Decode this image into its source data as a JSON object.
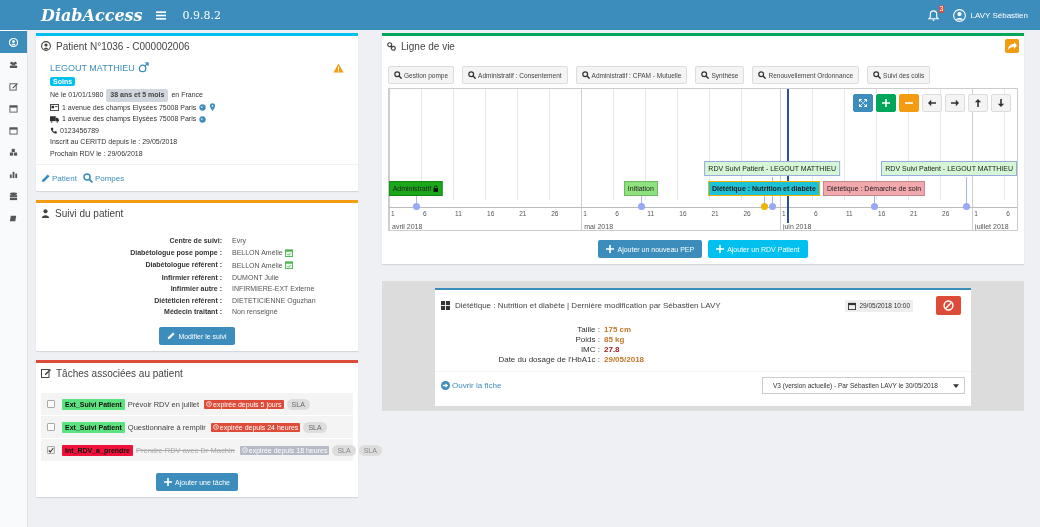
{
  "header": {
    "logo": "DiabAccess",
    "version": "0.9.8.2",
    "notifications": "3",
    "user": "LAVY Sébastien"
  },
  "sidebar": {
    "items": [
      {
        "selected": true
      },
      {
        "selected": false
      },
      {
        "selected": false
      },
      {
        "selected": false
      },
      {
        "selected": false
      },
      {
        "selected": false
      },
      {
        "selected": false
      },
      {
        "selected": false
      },
      {
        "selected": false
      }
    ]
  },
  "patient": {
    "title": "Patient N°1036 - C000002006",
    "name": "LEGOUT MATTHIEU",
    "badge": "Soins",
    "born": "Né le 01/01/1980",
    "age": "38 ans et 5 mois",
    "birthplace": "en France",
    "address_home": "1 avenue des champs Elysées 75008 Paris",
    "address_delivery": "1 avenue des champs Elysées 75008 Paris",
    "phone": "0123456789",
    "registered": "Inscrit au CERITD depuis le : 29/05/2018",
    "next_visit": "Prochain RDV le : 29/06/2018",
    "links": [
      "Patient",
      "Pompes"
    ]
  },
  "follow_up": {
    "title": "Suivi du patient",
    "rows": [
      {
        "label": "Centre de suivi:",
        "value": "Evry",
        "calendar": false
      },
      {
        "label": "Diabétologue pose pompe :",
        "value": "BELLON Amélie",
        "calendar": true
      },
      {
        "label": "Diabétologue référent :",
        "value": "BELLON Amélie",
        "calendar": true
      },
      {
        "label": "Infirmier référent :",
        "value": "DUMONT Julie",
        "calendar": false
      },
      {
        "label": "Infirmier autre :",
        "value": "INFIRMIERE-EXT Externe",
        "calendar": false
      },
      {
        "label": "Diététicien référent :",
        "value": "DIETETICIENNE Oguzhan",
        "calendar": false
      },
      {
        "label": "Médecin traitant :",
        "value": "Non renseigné",
        "calendar": false
      }
    ],
    "button": "Modifier le suivi"
  },
  "tasks": {
    "title": "Tâches associées au patient",
    "rows": [
      {
        "checked": false,
        "tag": "Ext_Suivi Patient",
        "color": "#5ce27e",
        "title": "Prévoir RDV en juillet",
        "expiry": "expirée depuis 5 jours",
        "sla": [
          "SLA"
        ]
      },
      {
        "checked": false,
        "tag": "Ext_Suivi Patient",
        "color": "#5ce27e",
        "title": "Questionnaire à remplir",
        "expiry": "expirée depuis 24 heures",
        "sla": [
          "SLA"
        ]
      },
      {
        "checked": true,
        "tag": "Int_RDV_a_prendre",
        "color": "#f0103c",
        "title": "Prendre RDV avec Dr Machin",
        "expiry": "expirée depuis 18 heures",
        "sla": [
          "SLA",
          "SLA"
        ]
      }
    ],
    "button": "Ajouter une tâche"
  },
  "timeline": {
    "title": "Ligne de vie",
    "filters": [
      "Gestion pompe",
      "Administratif : Consentement",
      "Administratif : CPAM - Mutuelle",
      "Synthèse",
      "Renouvellement Ordonnance",
      "Suivi des colis"
    ],
    "months": [
      {
        "label": "avril 2018",
        "ticks": [
          "1",
          "6",
          "11",
          "16",
          "21",
          "26"
        ]
      },
      {
        "label": "mai 2018",
        "ticks": [
          "1",
          "6",
          "11",
          "16",
          "21",
          "26"
        ]
      },
      {
        "label": "juin 2018",
        "ticks": [
          "1",
          "6",
          "11",
          "16",
          "21",
          "26"
        ]
      },
      {
        "label": "juillet 2018",
        "ticks": [
          "1",
          "6"
        ]
      }
    ],
    "events": [
      {
        "label": "Administratif",
        "kind": "step",
        "color": "#1aa81a",
        "selected": false,
        "locked": true
      },
      {
        "label": "Initiation",
        "kind": "step",
        "color": "#8ee27e",
        "selected": false,
        "locked": false
      },
      {
        "label": "RDV Suivi Patient - LEGOUT MATTHIEU",
        "kind": "rdv",
        "color": "#d5f7d5",
        "selected": false,
        "locked": false
      },
      {
        "label": "Diététique : Nutrition et diabète",
        "kind": "step",
        "color": "#1ec2d6",
        "selected": true,
        "locked": false
      },
      {
        "label": "Diététique : Démarche de soin",
        "kind": "step",
        "color": "#f2a8ad",
        "selected": false,
        "locked": false
      },
      {
        "label": "RDV Suivi Patient - LEGOUT MATTHIEU",
        "kind": "rdv",
        "color": "#d5f7d5",
        "selected": false,
        "locked": false
      }
    ],
    "buttons": [
      "Ajouter un nouveau PEP",
      "Ajouter un RDV Patient"
    ]
  },
  "record": {
    "title": "Diététique : Nutrition et diabète | Dernière modification par Sébastien LAVY",
    "date": "29/05/2018 10:00",
    "fields": [
      {
        "label": "Taille :",
        "value": "175 cm",
        "color": "#c0782a"
      },
      {
        "label": "Poids :",
        "value": "85 kg",
        "color": "#c0782a"
      },
      {
        "label": "IMC :",
        "value": "27.8",
        "color": "#a31d1d"
      },
      {
        "label": "Date du dosage de l'HbA1c :",
        "value": "29/05/2018",
        "color": "#c0782a"
      }
    ],
    "link": "Ouvrir la fiche",
    "version": "V3 (version actuelle) - Par Sébastien LAVY le 30/05/2018"
  }
}
